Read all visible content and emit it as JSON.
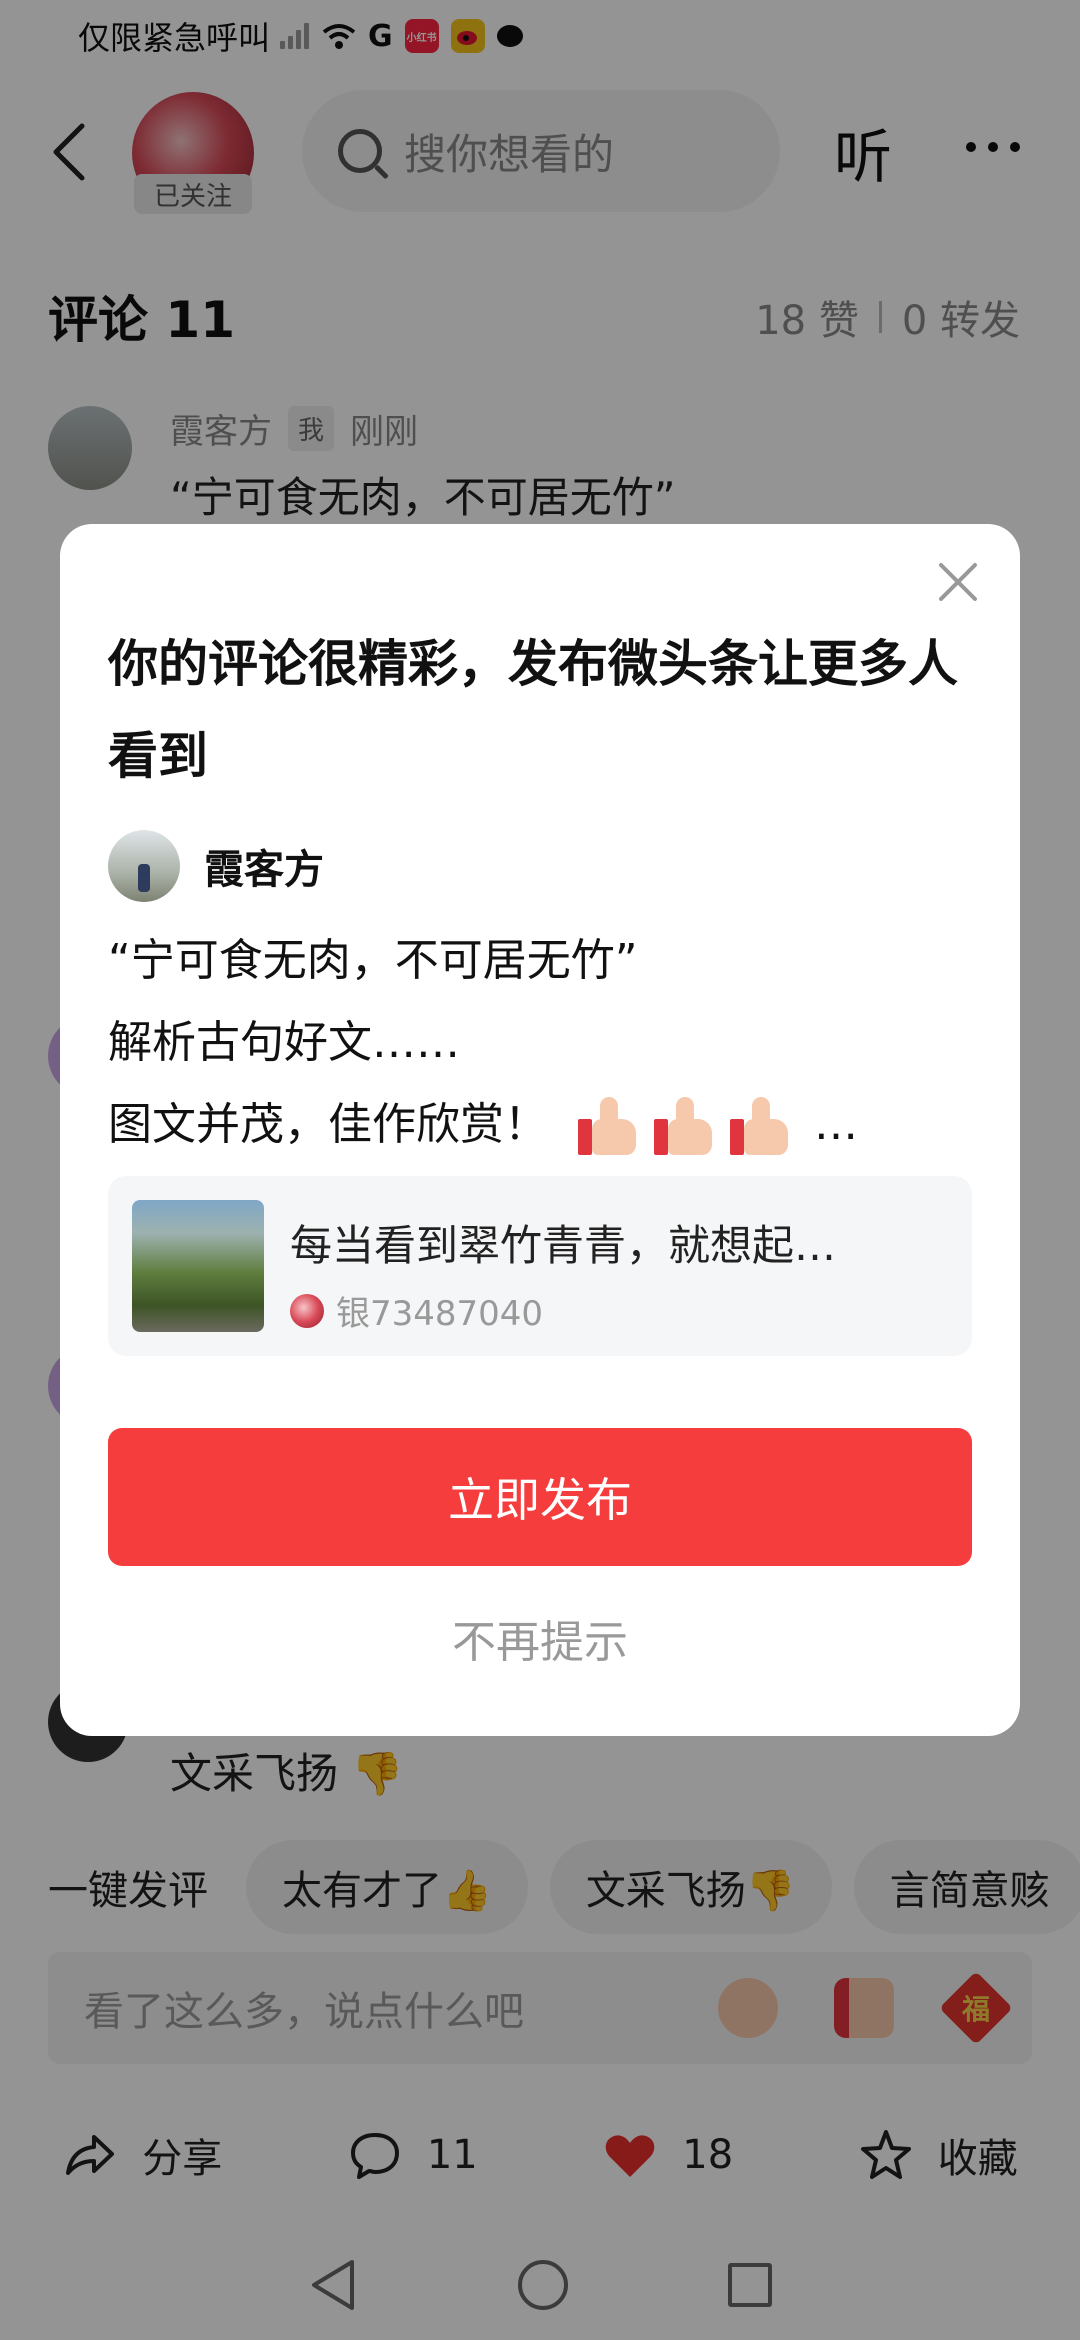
{
  "status_bar": {
    "text": "仅限紧急呼叫",
    "icons": [
      "signal-icon",
      "wifi-icon",
      "g-icon",
      "xiaohongshu-icon",
      "weibo-icon",
      "chat-icon"
    ],
    "xhs_label": "小红书"
  },
  "header": {
    "follow_label": "已关注",
    "search_placeholder": "搜你想看的",
    "listen_label": "听"
  },
  "comments": {
    "title": "评论 11",
    "likes": "18 赞",
    "reposts": "0 转发",
    "first": {
      "user": "霞客方",
      "me_tag": "我",
      "time": "刚刚",
      "text": "“宁可食无肉，不可居无竹”"
    },
    "last_visible_text": "文采飞扬 👎"
  },
  "quick_comments": {
    "label": "一键发评",
    "chips": [
      "太有才了👍",
      "文采飞扬👎",
      "言简意赅"
    ]
  },
  "input": {
    "placeholder": "看了这么多，说点什么吧",
    "fu_char": "福"
  },
  "bottom_actions": {
    "share": "分享",
    "comment_count": "11",
    "like_count": "18",
    "favorite": "收藏"
  },
  "modal": {
    "title": "你的评论很精彩，发布微头条让更多人看到",
    "author": "霞客方",
    "body_line1": "“宁可食无肉，不可居无竹”",
    "body_line2": "解析古句好文……",
    "body_line3": "图文并茂，佳作欣赏！",
    "body_ellipsis": "…",
    "card_title": "每当看到翠竹青青，就想起…",
    "card_source": "银73487040",
    "publish_label": "立即发布",
    "dismiss_label": "不再提示"
  },
  "colors": {
    "accent": "#f53d3d",
    "overlay": "rgba(0,0,0,0.42)"
  }
}
